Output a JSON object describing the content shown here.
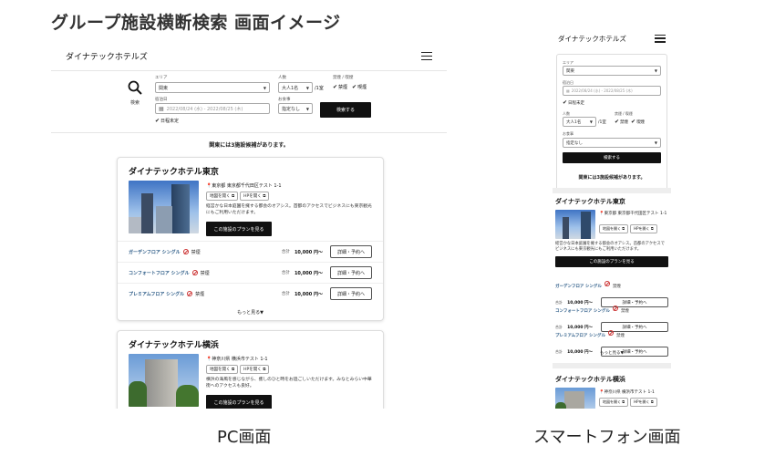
{
  "title": "グループ施設横断検索 画面イメージ",
  "captions": {
    "pc": "PC画面",
    "sp": "スマートフォン画面"
  },
  "brand": "ダイナテックホテルズ",
  "search": {
    "button_label": "検索",
    "area_label": "エリア",
    "area_value": "関東",
    "guests_label": "人数",
    "guests_value": "大人1名",
    "per_room": "/1室",
    "smoking_label": "禁煙 / 喫煙",
    "nonsmoking": "禁煙",
    "smoking": "喫煙",
    "dates_label": "宿泊日",
    "dates_value": "2022/08/24 (水) - 2022/08/25 (木)",
    "undecided": "日程未定",
    "meal_label": "お食事",
    "meal_value": "指定なし",
    "submit_label": "検索する"
  },
  "result_count": "関東には3施設候補があります。",
  "hotels": [
    {
      "name": "ダイナテックホテル東京",
      "address": "東京都 東京都千代田区テスト 1-1",
      "map_button": "地図を開く",
      "hp_button": "HPを開く",
      "description": "経営かな日本庭園を擁する都会のオアシス。首都のアクセスでビジネスにも東京観光にもご利用いただけます。",
      "plan_button": "この施設のプランを見る",
      "rooms": [
        {
          "name": "ガーデンフロア シングル",
          "smoking": "禁煙",
          "total": "合計",
          "price": "10,000 円〜",
          "detail": "詳細・予約へ"
        },
        {
          "name": "コンフォートフロア シングル",
          "smoking": "禁煙",
          "total": "合計",
          "price": "10,000 円〜",
          "detail": "詳細・予約へ"
        },
        {
          "name": "プレミアムフロア シングル",
          "smoking": "禁煙",
          "total": "合計",
          "price": "10,000 円〜",
          "detail": "詳細・予約へ"
        }
      ],
      "more": "もっと見る▼"
    },
    {
      "name": "ダイナテックホテル横浜",
      "address": "神奈川県 横浜市テスト 1-1",
      "map_button": "地図を開く",
      "hp_button": "HPを開く",
      "description": "横浜の海風を感じながら、癒しのひと時をお過ごしいただけます。みなとみらい中華街へのアクセスも良好。",
      "plan_button": "この施設のプランを見る"
    }
  ],
  "sp": {
    "hotel1_address": "東京都 東京都千代田区テスト 1-1",
    "hotel1_description": "経営かな日本庭園を擁する都会のオアシス。首都のアクセスでビジネスにも東京観光にもご利用いただけます。",
    "hotel2_address": "神奈川県 横浜市テスト 1-1"
  }
}
